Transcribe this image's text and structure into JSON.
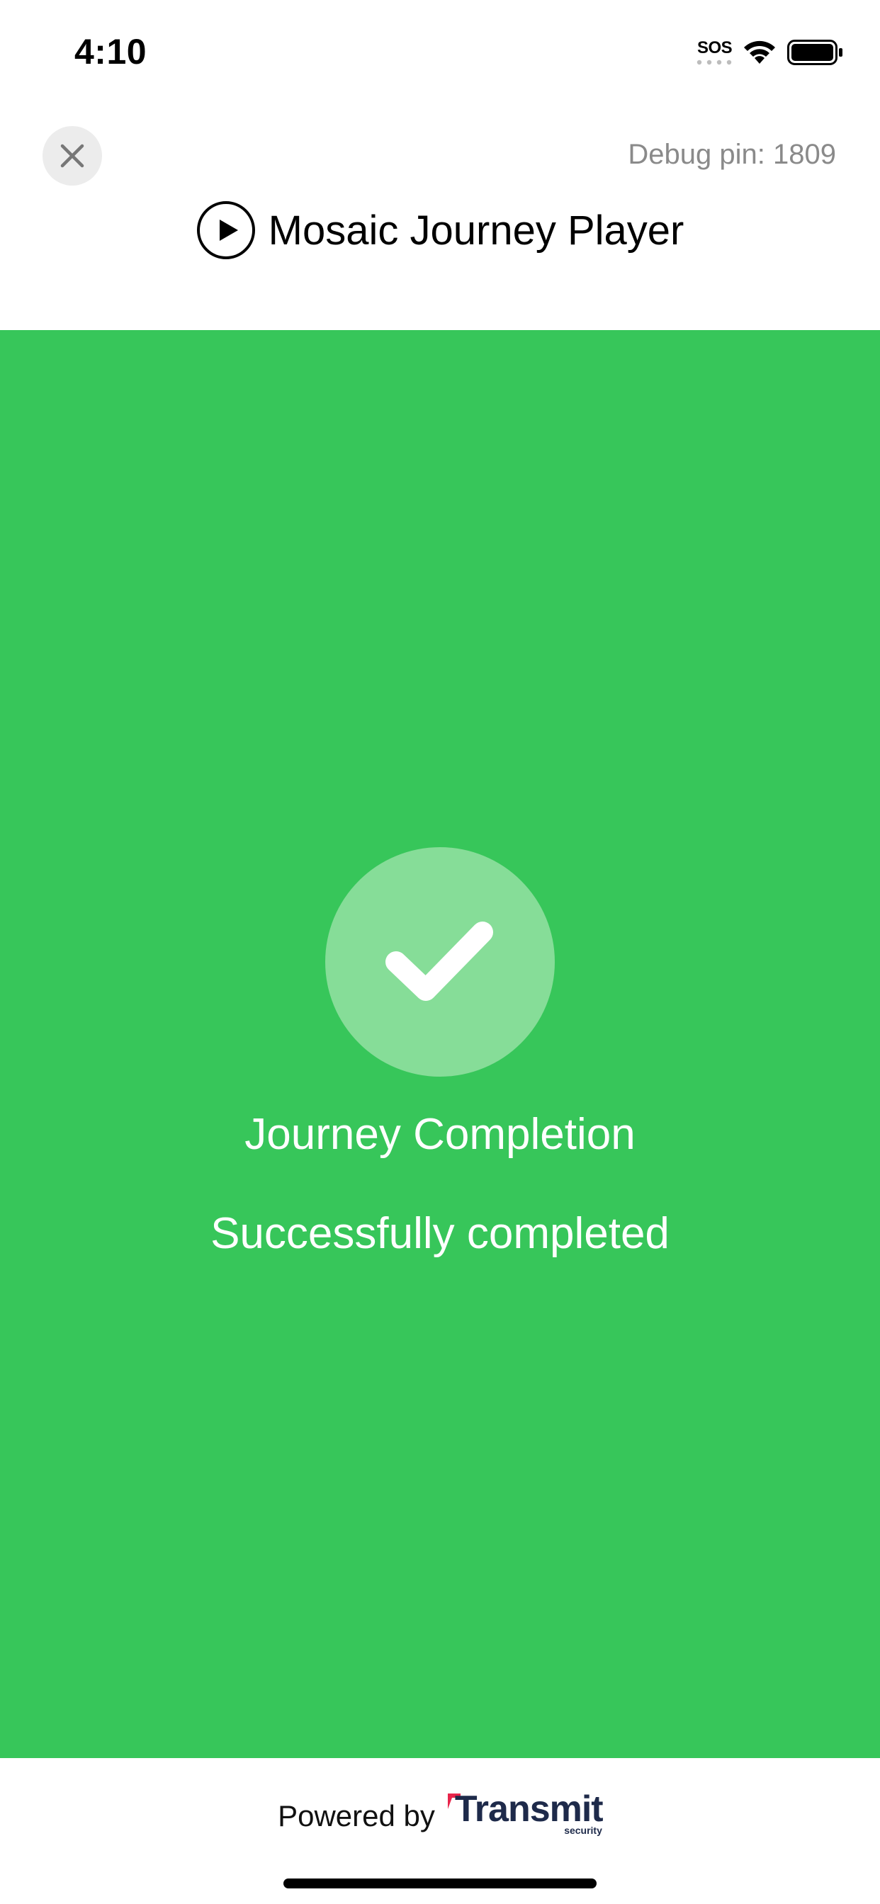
{
  "status_bar": {
    "time": "4:10",
    "sos": "SOS"
  },
  "header": {
    "debug_pin": "Debug pin: 1809",
    "title": "Mosaic Journey Player"
  },
  "main": {
    "background_color": "#37c65a",
    "headline": "Journey Completion",
    "message": "Successfully completed"
  },
  "footer": {
    "powered_by": "Powered by",
    "brand_name": "Transmit",
    "brand_sub": "security",
    "brand_color": "#1e2a4a",
    "brand_accent": "#e8254b"
  }
}
